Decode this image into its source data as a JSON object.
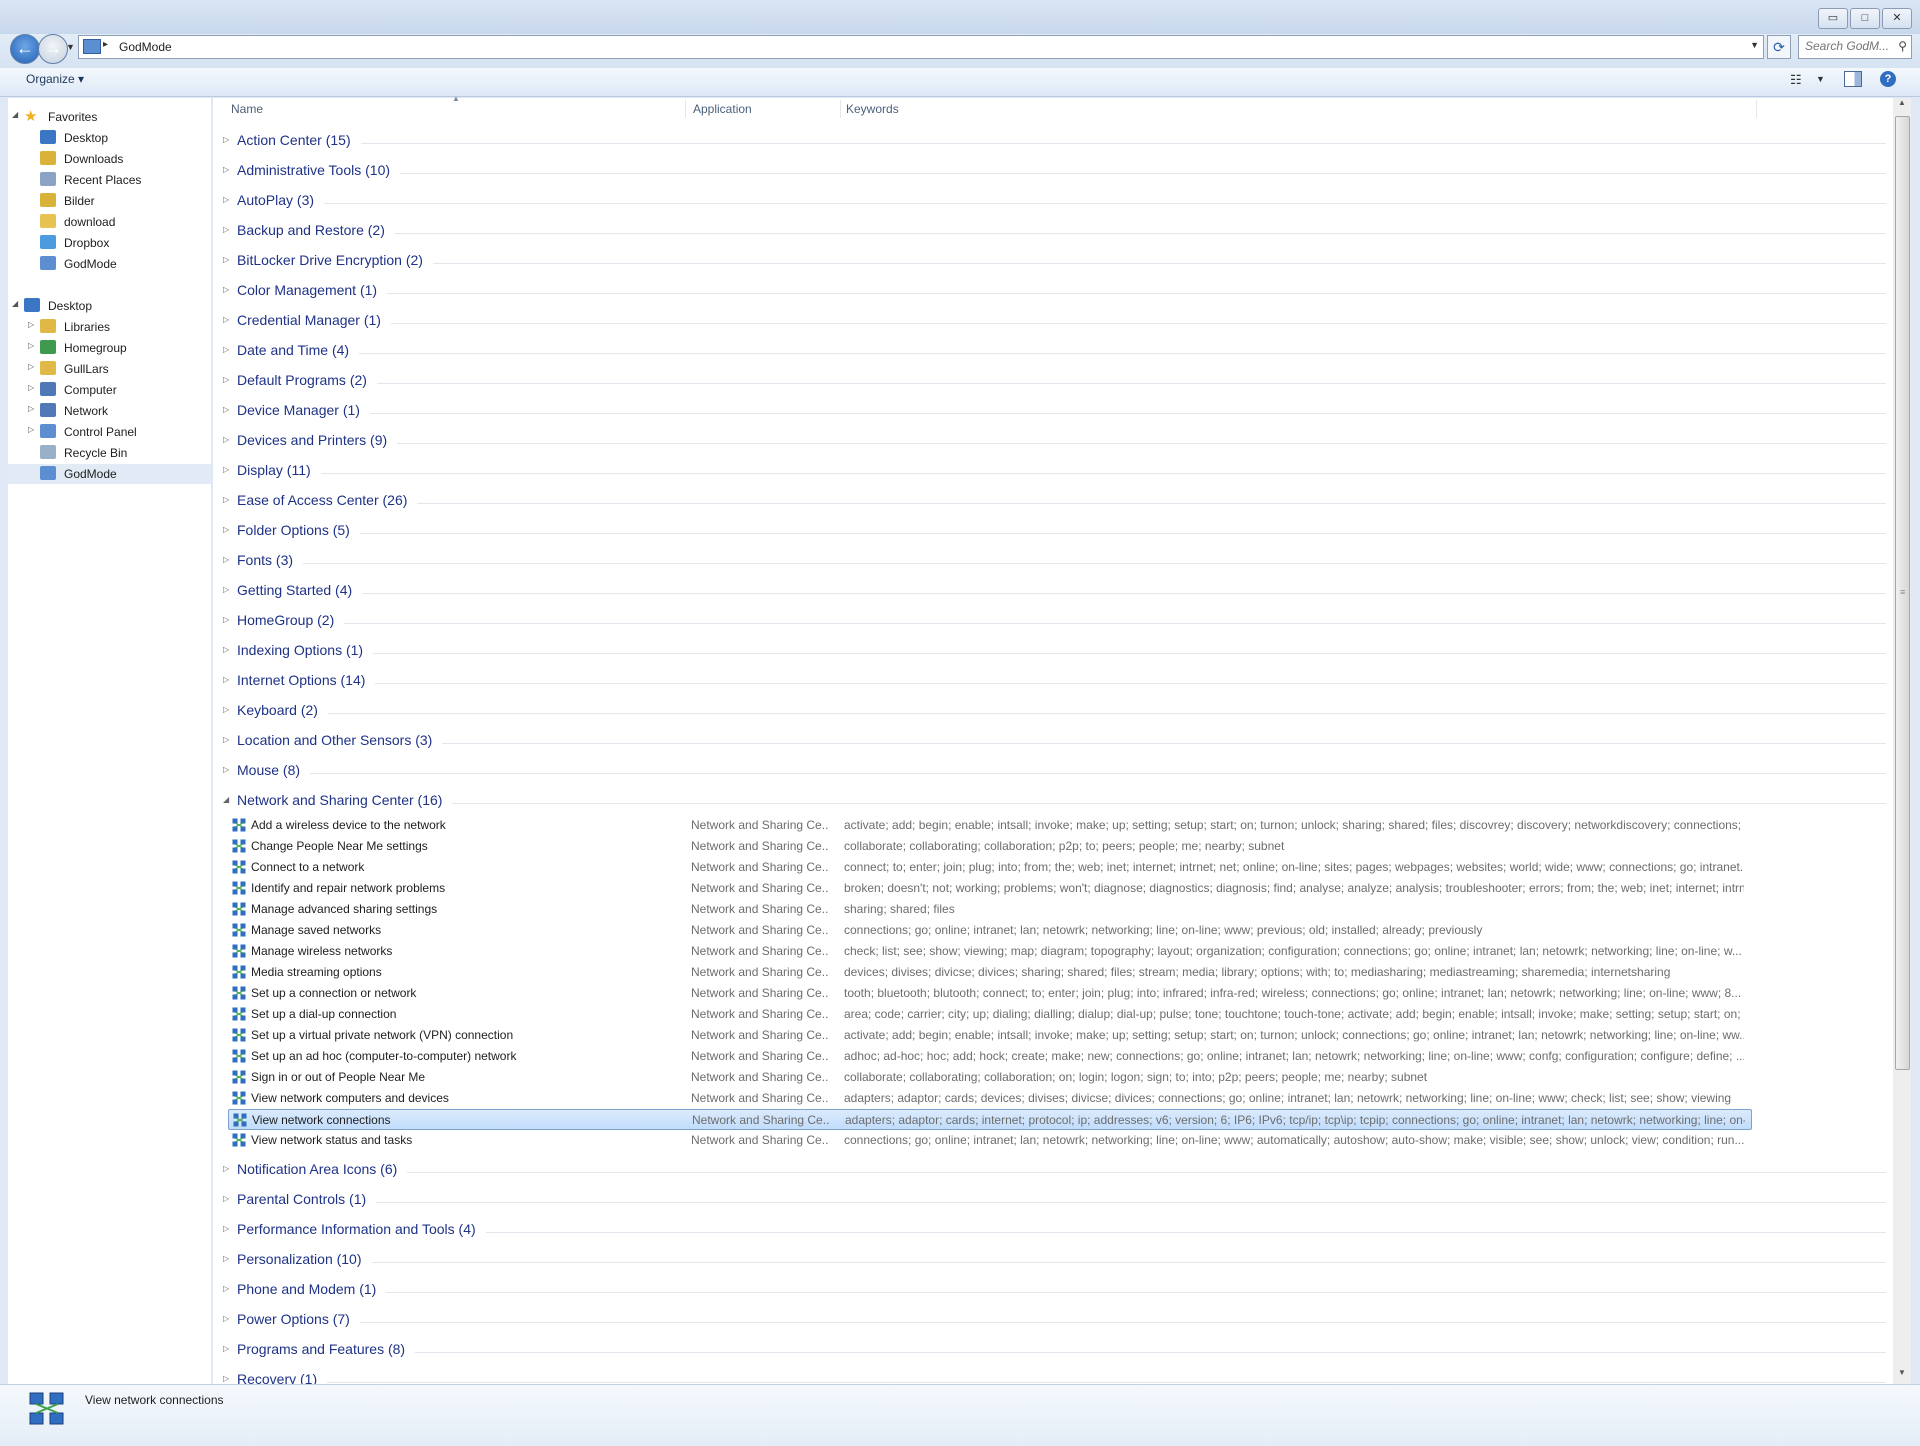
{
  "window": {
    "minimize": "▭",
    "maximize": "□",
    "close": "✕"
  },
  "address": {
    "location": "GodMode",
    "search_placeholder": "Search GodM..."
  },
  "toolbar": {
    "organize_label": "Organize"
  },
  "sidebar": {
    "favorites_label": "Favorites",
    "favorites": [
      "Desktop",
      "Downloads",
      "Recent Places",
      "Bilder",
      "download",
      "Dropbox",
      "GodMode"
    ],
    "desktop_label": "Desktop",
    "desktop_children": [
      "Libraries",
      "Homegroup",
      "GullLars",
      "Computer",
      "Network",
      "Control Panel",
      "Recycle Bin",
      "GodMode"
    ],
    "selected": "GodMode"
  },
  "columns": {
    "name": "Name",
    "application": "Application",
    "keywords": "Keywords"
  },
  "groups_before": [
    "Action Center (15)",
    "Administrative Tools (10)",
    "AutoPlay (3)",
    "Backup and Restore (2)",
    "BitLocker Drive Encryption (2)",
    "Color Management (1)",
    "Credential Manager (1)",
    "Date and Time (4)",
    "Default Programs (2)",
    "Device Manager (1)",
    "Devices and Printers (9)",
    "Display (11)",
    "Ease of Access Center (26)",
    "Folder Options (5)",
    "Fonts (3)",
    "Getting Started (4)",
    "HomeGroup (2)",
    "Indexing Options (1)",
    "Internet Options (14)",
    "Keyboard (2)",
    "Location and Other Sensors (3)",
    "Mouse (8)"
  ],
  "expanded_group": "Network and Sharing Center (16)",
  "items": [
    {
      "name": "Add a wireless device to the network",
      "app": "Network and Sharing Ce...",
      "keywords": "activate; add; begin; enable; intsall; invoke; make; up; setting; setup; start; on; turnon; unlock; sharing; shared; files; discovrey; discovery; networkdiscovery; connections; g..."
    },
    {
      "name": "Change People Near Me settings",
      "app": "Network and Sharing Ce...",
      "keywords": "collaborate; collaborating; collaboration; p2p; to; peers; people; me; nearby; subnet"
    },
    {
      "name": "Connect to a network",
      "app": "Network and Sharing Ce...",
      "keywords": "connect; to; enter; join; plug; into; from; the; web; inet; internet; intrnet; net; online; on-line; sites; pages; webpages; websites; world; wide; www; connections; go; intranet..."
    },
    {
      "name": "Identify and repair network problems",
      "app": "Network and Sharing Ce...",
      "keywords": "broken; doesn't; not; working; problems; won't; diagnose; diagnostics; diagnosis; find; analyse; analyze; analysis; troubleshooter; errors; from; the; web; inet; internet; intrn..."
    },
    {
      "name": "Manage advanced sharing settings",
      "app": "Network and Sharing Ce...",
      "keywords": "sharing; shared; files"
    },
    {
      "name": "Manage saved networks",
      "app": "Network and Sharing Ce...",
      "keywords": "connections; go; online; intranet; lan; netowrk; networking; line; on-line; www; previous; old; installed; already; previously"
    },
    {
      "name": "Manage wireless networks",
      "app": "Network and Sharing Ce...",
      "keywords": "check; list; see; show; viewing; map; diagram; topography; layout; organization; configuration; connections; go; online; intranet; lan; netowrk; networking; line; on-line; w..."
    },
    {
      "name": "Media streaming options",
      "app": "Network and Sharing Ce...",
      "keywords": "devices; divises; divicse; divices; sharing; shared; files; stream; media; library; options; with; to; mediasharing; mediastreaming; sharemedia; internetsharing"
    },
    {
      "name": "Set up a connection or network",
      "app": "Network and Sharing Ce...",
      "keywords": "tooth; bluetooth; blutooth; connect; to; enter; join; plug; into; infrared; infra-red; wireless; connections; go; online; intranet; lan; netowrk; networking; line; on-line; www; 8..."
    },
    {
      "name": "Set up a dial-up connection",
      "app": "Network and Sharing Ce...",
      "keywords": "area; code; carrier; city; up; dialing; dialling; dialup; dial-up; pulse; tone; touchtone; touch-tone; activate; add; begin; enable; intsall; invoke; make; setting; setup; start; on; ..."
    },
    {
      "name": "Set up a virtual private network (VPN) connection",
      "app": "Network and Sharing Ce...",
      "keywords": "activate; add; begin; enable; intsall; invoke; make; up; setting; setup; start; on; turnon; unlock; connections; go; online; intranet; lan; netowrk; networking; line; on-line; ww..."
    },
    {
      "name": "Set up an ad hoc (computer-to-computer) network",
      "app": "Network and Sharing Ce...",
      "keywords": "adhoc; ad-hoc; hoc; add; hock; create; make; new; connections; go; online; intranet; lan; netowrk; networking; line; on-line; www; confg; configuration; configure; define; ..."
    },
    {
      "name": "Sign in or out of People Near Me",
      "app": "Network and Sharing Ce...",
      "keywords": "collaborate; collaborating; collaboration; on; login; logon; sign; to; into; p2p; peers; people; me; nearby; subnet"
    },
    {
      "name": "View network computers and devices",
      "app": "Network and Sharing Ce...",
      "keywords": "adapters; adaptor; cards; devices; divises; divicse; divices; connections; go; online; intranet; lan; netowrk; networking; line; on-line; www; check; list; see; show; viewing"
    },
    {
      "name": "View network connections",
      "app": "Network and Sharing Ce...",
      "keywords": "adapters; adaptor; cards; internet; protocol; ip; addresses; v6; version; 6; IP6; IPv6; tcp/ip; tcp\\ip; tcpip; connections; go; online; intranet; lan; netowrk; networking; line; on-..."
    },
    {
      "name": "View network status and tasks",
      "app": "Network and Sharing Ce...",
      "keywords": "connections; go; online; intranet; lan; netowrk; networking; line; on-line; www; automatically; autoshow; auto-show; make; visible; see; show; unlock; view; condition; run..."
    }
  ],
  "selected_item": "View network connections",
  "groups_after": [
    "Notification Area Icons (6)",
    "Parental Controls (1)",
    "Performance Information and Tools (4)",
    "Personalization (10)",
    "Phone and Modem (1)",
    "Power Options (7)",
    "Programs and Features (8)",
    "Recovery (1)"
  ],
  "details": {
    "text": "View network connections"
  },
  "colors": {
    "group_text": "#1e3287",
    "selection": "#c1dcfc",
    "accent": "#2f6ec0"
  }
}
